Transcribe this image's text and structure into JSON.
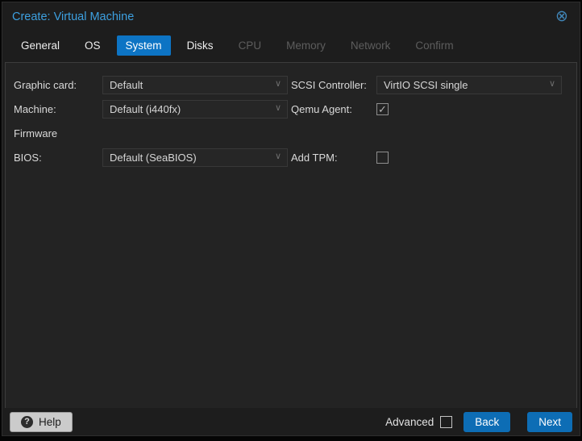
{
  "window": {
    "title": "Create: Virtual Machine"
  },
  "icons": {
    "close": "⊗",
    "chevron": "∨",
    "check": "✓",
    "help": "?"
  },
  "tabs": [
    {
      "label": "General",
      "state": "enabled"
    },
    {
      "label": "OS",
      "state": "enabled"
    },
    {
      "label": "System",
      "state": "active"
    },
    {
      "label": "Disks",
      "state": "enabled"
    },
    {
      "label": "CPU",
      "state": "disabled"
    },
    {
      "label": "Memory",
      "state": "disabled"
    },
    {
      "label": "Network",
      "state": "disabled"
    },
    {
      "label": "Confirm",
      "state": "disabled"
    }
  ],
  "form": {
    "graphic_card": {
      "label": "Graphic card:",
      "value": "Default"
    },
    "machine": {
      "label": "Machine:",
      "value": "Default (i440fx)"
    },
    "firmware_heading": "Firmware",
    "bios": {
      "label": "BIOS:",
      "value": "Default (SeaBIOS)"
    },
    "scsi_controller": {
      "label": "SCSI Controller:",
      "value": "VirtIO SCSI single"
    },
    "qemu_agent": {
      "label": "Qemu Agent:",
      "checked": true
    },
    "add_tpm": {
      "label": "Add TPM:",
      "checked": false
    }
  },
  "footer": {
    "help_label": "Help",
    "advanced_label": "Advanced",
    "advanced_checked": false,
    "back_label": "Back",
    "next_label": "Next"
  },
  "colors": {
    "accent_blue": "#0d74c4",
    "button_blue": "#0d6db5",
    "title_blue": "#3da0e0",
    "panel_bg": "#232323",
    "dialog_bg": "#1d1d1d"
  }
}
